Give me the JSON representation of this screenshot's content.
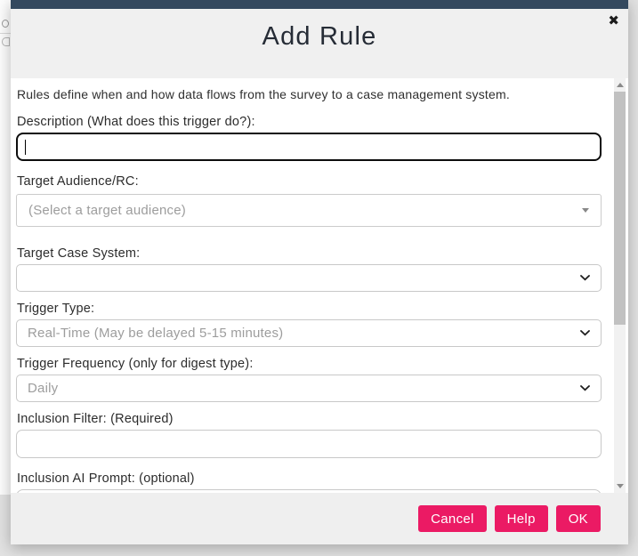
{
  "colors": {
    "accent_navy": "#34495e",
    "button_pink": "#eb1a64",
    "header_gray": "#f0f0f0",
    "footer_gray": "#efefef",
    "page_gray": "#e2e2e2"
  },
  "modal": {
    "title": "Add Rule",
    "close_icon": "✖",
    "intro": "Rules define when and how data flows from the survey to a case management system.",
    "fields": {
      "description": {
        "label": "Description (What does this trigger do?):",
        "value": ""
      },
      "target_audience": {
        "label": "Target Audience/RC:",
        "selected": "(Select a target audience)"
      },
      "target_case_system": {
        "label": "Target Case System:",
        "selected": ""
      },
      "trigger_type": {
        "label": "Trigger Type:",
        "selected": "Real-Time (May be delayed 5-15 minutes)"
      },
      "trigger_frequency": {
        "label": "Trigger Frequency (only for digest type):",
        "selected": "Daily"
      },
      "inclusion_filter": {
        "label": "Inclusion Filter: (Required)",
        "value": ""
      },
      "inclusion_ai_prompt": {
        "label": "Inclusion AI Prompt: (optional)",
        "value": ""
      }
    },
    "buttons": {
      "cancel": "Cancel",
      "help": "Help",
      "ok": "OK"
    }
  }
}
